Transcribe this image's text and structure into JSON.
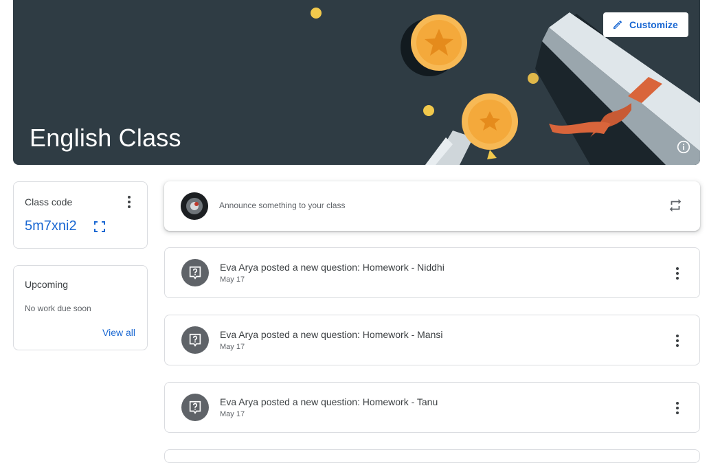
{
  "banner": {
    "class_title": "English Class",
    "customize_label": "Customize",
    "background_color": "#2f3c44"
  },
  "class_code_card": {
    "label": "Class code",
    "code": "5m7xni2"
  },
  "upcoming_card": {
    "label": "Upcoming",
    "status": "No work due soon",
    "view_all": "View all"
  },
  "announce": {
    "placeholder": "Announce something to your class"
  },
  "posts": [
    {
      "title": "Eva Arya posted a new question: Homework - Niddhi",
      "date": "May 17"
    },
    {
      "title": "Eva Arya posted a new question: Homework - Mansi",
      "date": "May 17"
    },
    {
      "title": "Eva Arya posted a new question: Homework - Tanu",
      "date": "May 17"
    }
  ],
  "colors": {
    "accent": "#1967d2",
    "text": "#3c4043",
    "muted": "#5f6368",
    "border": "#dadce0"
  }
}
